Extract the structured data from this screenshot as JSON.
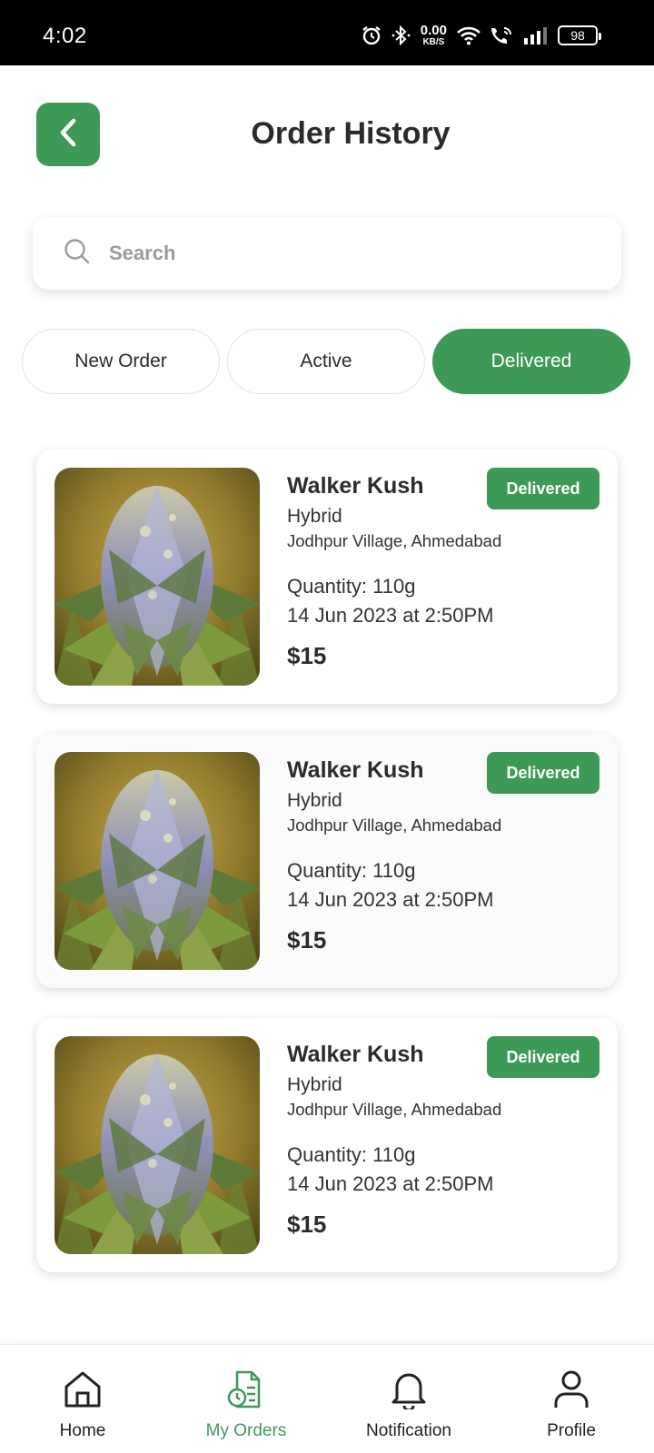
{
  "status_bar": {
    "time": "4:02",
    "net_speed_value": "0.00",
    "net_speed_unit": "KB/S",
    "battery": "98",
    "icons": [
      "alarm-icon",
      "bluetooth-icon",
      "wifi-icon",
      "wifi-calling-icon",
      "signal-icon",
      "battery-icon"
    ]
  },
  "header": {
    "title": "Order History",
    "back_icon": "chevron-left-icon"
  },
  "search": {
    "placeholder": "Search",
    "value": ""
  },
  "tabs": [
    {
      "label": "New Order",
      "active": false
    },
    {
      "label": "Active",
      "active": false
    },
    {
      "label": "Delivered",
      "active": true
    }
  ],
  "orders": [
    {
      "name": "Walker Kush",
      "type": "Hybrid",
      "location": "Jodhpur Village, Ahmedabad",
      "quantity": "Quantity: 110g",
      "date": "14 Jun 2023 at 2:50PM",
      "price": "$15",
      "status": "Delivered"
    },
    {
      "name": "Walker Kush",
      "type": "Hybrid",
      "location": "Jodhpur Village, Ahmedabad",
      "quantity": "Quantity: 110g",
      "date": "14 Jun 2023 at 2:50PM",
      "price": "$15",
      "status": "Delivered"
    },
    {
      "name": "Walker Kush",
      "type": "Hybrid",
      "location": "Jodhpur Village, Ahmedabad",
      "quantity": "Quantity: 110g",
      "date": "14 Jun 2023 at 2:50PM",
      "price": "$15",
      "status": "Delivered"
    }
  ],
  "bottom_nav": [
    {
      "label": "Home",
      "icon": "home-icon",
      "active": false
    },
    {
      "label": "My Orders",
      "icon": "orders-icon",
      "active": true
    },
    {
      "label": "Notification",
      "icon": "bell-icon",
      "active": false
    },
    {
      "label": "Profile",
      "icon": "user-icon",
      "active": false
    }
  ],
  "colors": {
    "accent": "#3d9a56",
    "text": "#2b2b2b",
    "placeholder": "#9a9a9a"
  }
}
